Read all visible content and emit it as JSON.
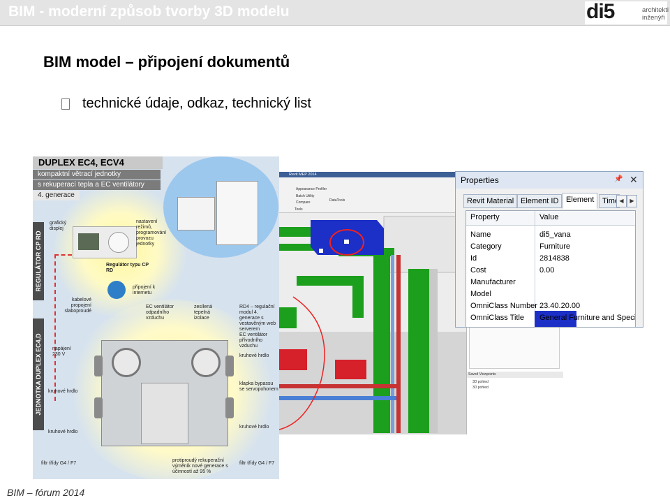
{
  "header": {
    "title": "BIM - moderní způsob tvorby 3D modelu",
    "logo_mark": "di5",
    "logo_sub_1": "architekti",
    "logo_sub_2": "inženýři"
  },
  "slide": {
    "title": "BIM model – připojení dokumentů",
    "bullet": "technické údaje, odkaz, technický list"
  },
  "footer": {
    "text": "BIM – fórum 2014"
  },
  "brochure": {
    "title": "DUPLEX EC4, ECV4",
    "line1": "kompaktní větrací jednotky",
    "line2": "s rekuperací tepla a EC ventilátory",
    "line3": "4. generace",
    "band1": "REGULÁTOR CP RD",
    "band2": "JEDNOTKA DUPLEX EC4,D",
    "labels": {
      "display": "grafický displej",
      "modes": "nastavení režimů, programování provozu jednotky",
      "regulator": "Regulátor typu CP RD",
      "internet": "připojení k internetu",
      "cable": "kabelové propojení slaboproudé",
      "ec_exhaust": "EC ventilátor odpadního vzduchu",
      "insulation": "zesílená tepelná izolace",
      "rd4": "RD4 – regulační modul 4. generace s vestavěným web serverem",
      "ec_supply": "EC ventilátor přívodního vzduchu",
      "power": "napájení 230 V",
      "round_neck_1": "kruhové hrdlo",
      "round_neck_2": "kruhové hrdlo",
      "round_neck_3": "kruhové hrdlo",
      "round_neck_4": "kruhové hrdlo",
      "bypass": "klapka bypassu se servopohonem",
      "filter_left": "filtr třídy G4 / F7",
      "filter_right": "filtr třídy G4 / F7",
      "exchanger": "protiproudý rekuperační výměník nové generace s účinností až 95 %"
    }
  },
  "revit": {
    "strip": "Revit MEP 2014",
    "ribbon": {
      "item1": "Appearance Profiler",
      "item2": "Batch Utility",
      "item3": "Compare",
      "item4": "DataTools",
      "item5": "Tools"
    },
    "saved_viewpoints": "Saved Viewpoints",
    "sv_item1": "3D pohled",
    "sv_item2": "3D pohled"
  },
  "properties": {
    "title": "Properties",
    "tabs": [
      "Revit Material",
      "Element ID",
      "Element",
      "Time"
    ],
    "active_tab": 2,
    "header_property": "Property",
    "header_value": "Value",
    "rows": [
      {
        "name": "Name",
        "value": "di5_vana"
      },
      {
        "name": "Category",
        "value": "Furniture"
      },
      {
        "name": "Id",
        "value": "2814838"
      },
      {
        "name": "Cost",
        "value": "0.00"
      },
      {
        "name": "Manufacturer",
        "value": ""
      },
      {
        "name": "Model",
        "value": ""
      },
      {
        "name": "OmniClass Number",
        "value": "23.40.20.00"
      },
      {
        "name": "OmniClass Title",
        "value": "General Furniture and Specia"
      }
    ]
  }
}
